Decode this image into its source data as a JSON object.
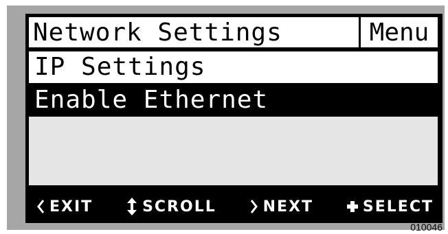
{
  "display": {
    "title": "Network Settings",
    "menu_tag": "Menu",
    "items": [
      {
        "label": "IP Settings",
        "selected": false
      },
      {
        "label": "Enable Ethernet",
        "selected": true
      }
    ]
  },
  "softkeys": [
    {
      "icon": "chevron-left-icon",
      "label": "EXIT"
    },
    {
      "icon": "up-down-arrow-icon",
      "label": "SCROLL"
    },
    {
      "icon": "chevron-right-icon",
      "label": "NEXT"
    },
    {
      "icon": "plus-icon",
      "label": "SELECT"
    }
  ],
  "figure_id": "010046",
  "colors": {
    "bezel": "#a6a6a6",
    "screen_dark": "#000000",
    "screen_light": "#ffffff",
    "empty_area": "#e5e5e5"
  }
}
